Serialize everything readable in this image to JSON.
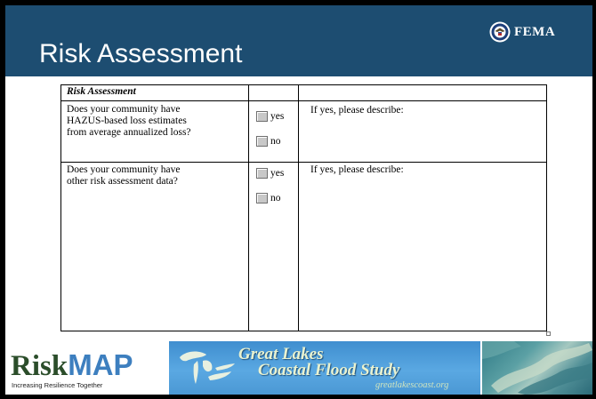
{
  "slide": {
    "title": "Risk Assessment",
    "logo_text": "FEMA"
  },
  "form": {
    "section_title": "Risk Assessment",
    "rows": [
      {
        "question_lines": [
          "Does your community have",
          "HAZUS-based loss estimates",
          "from average annualized loss?"
        ],
        "options": [
          "yes",
          "no"
        ],
        "describe": "If yes, please describe:"
      },
      {
        "question_lines": [
          "Does your community have",
          "other risk assessment data?"
        ],
        "options": [
          "yes",
          "no"
        ],
        "describe": "If yes, please describe:"
      }
    ]
  },
  "footer": {
    "riskmap_risk": "Risk",
    "riskmap_map": "MAP",
    "riskmap_tagline": "Increasing Resilience Together",
    "lakes_line1": "Great Lakes",
    "lakes_line2": "Coastal Flood Study",
    "lakes_url": "greatlakescoast.org"
  },
  "colors": {
    "header_bg": "#1d4d71",
    "checkbox": "#c8c8c8",
    "riskmap_green": "#2b4d2a",
    "riskmap_blue": "#3d7fbf",
    "lakes_blue": "#4b98d4"
  },
  "icons": {
    "fema_logo": "dhs-seal-icon",
    "lakes_graphic": "great-lakes-map-icon",
    "photo": "aerial-lakes-photo"
  }
}
